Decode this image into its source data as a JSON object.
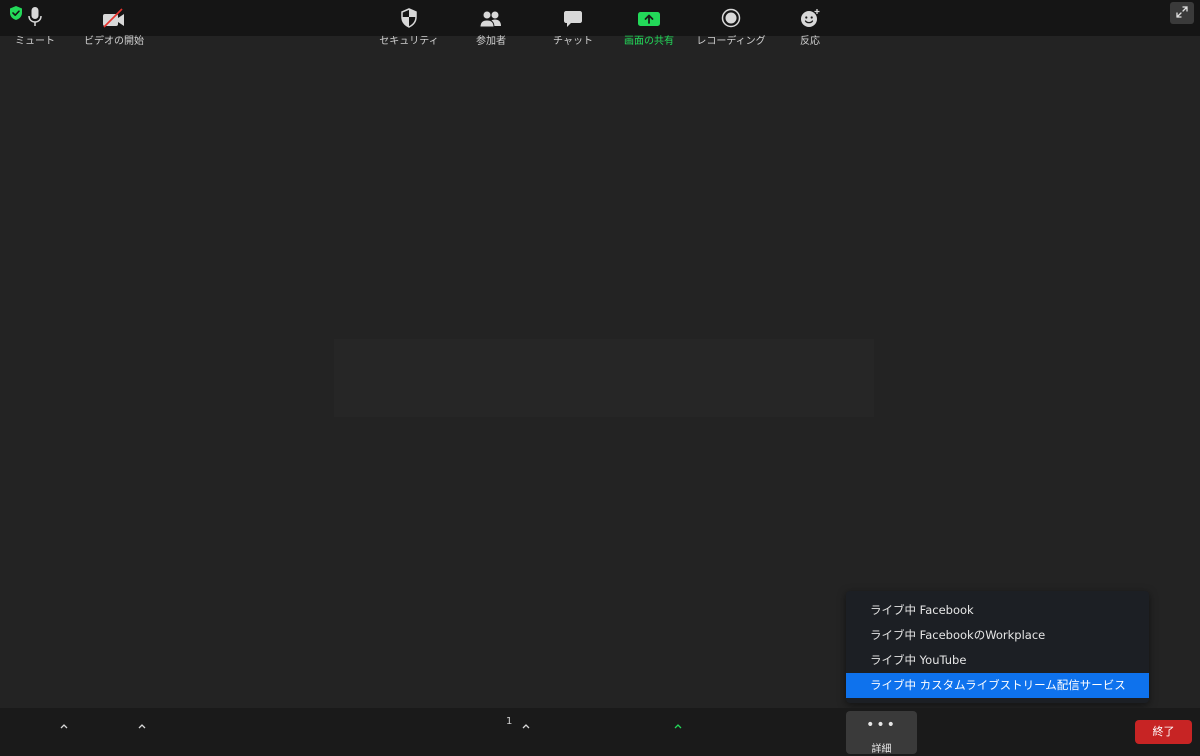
{
  "colors": {
    "accent_blue": "#0e72ed",
    "share_green": "#23d959",
    "end_red": "#c72424",
    "background": "#232323"
  },
  "top_bar": {
    "security_badge_icon": "green-shield-check-icon",
    "fullscreen_icon": "expand-icon"
  },
  "more_menu": {
    "items": [
      {
        "label": "ライブ中 Facebook"
      },
      {
        "label": "ライブ中 FacebookのWorkplace"
      },
      {
        "label": "ライブ中 YouTube"
      },
      {
        "label": "ライブ中 カスタムライブストリーム配信サービス",
        "highlighted": true
      }
    ]
  },
  "toolbar": {
    "mute_label": "ミュート",
    "video_label": "ビデオの開始",
    "security_label": "セキュリティ",
    "participants_label": "参加者",
    "participants_count": "1",
    "chat_label": "チャット",
    "share_label": "画面の共有",
    "record_label": "レコーディング",
    "reactions_label": "反応",
    "more_label": "詳細",
    "end_label": "終了"
  }
}
